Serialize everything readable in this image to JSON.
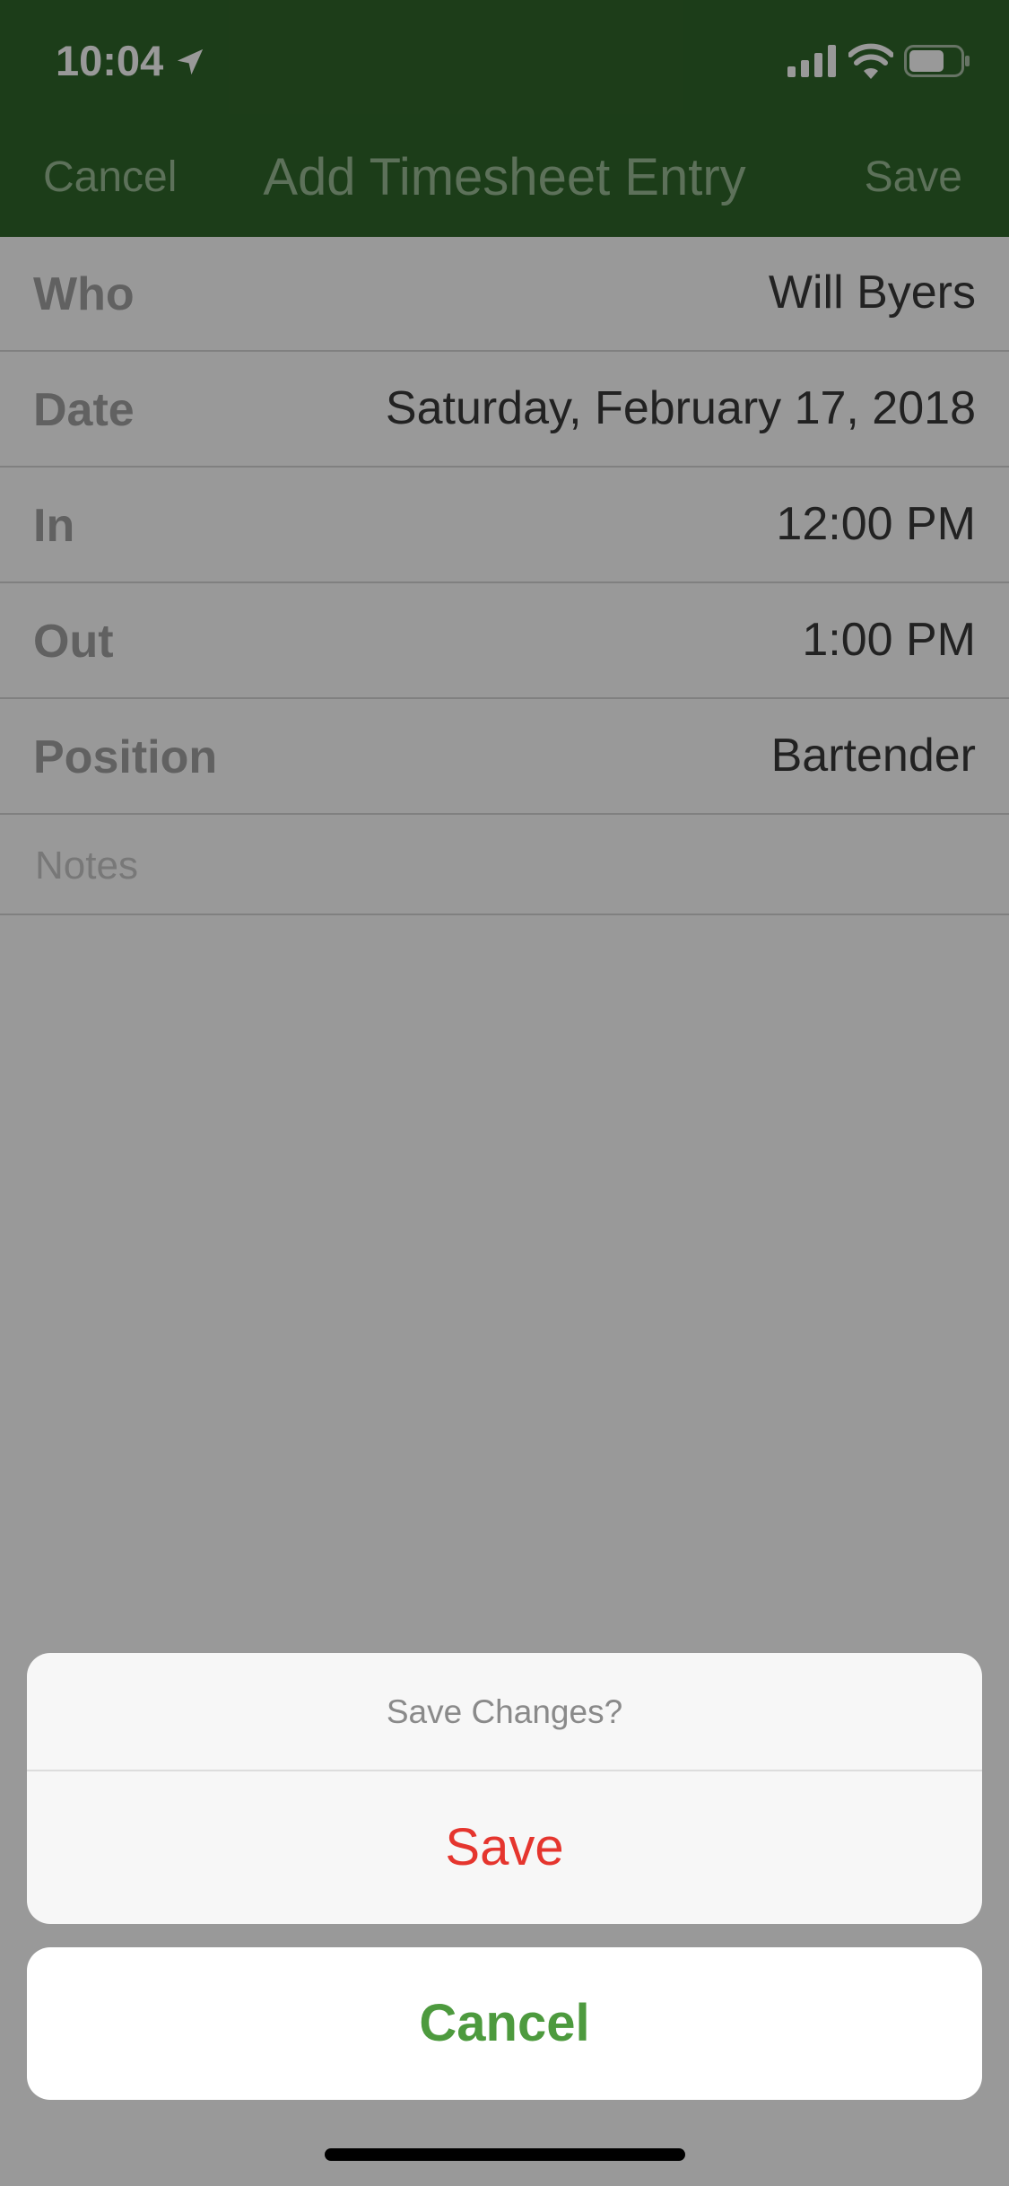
{
  "status_bar": {
    "time": "10:04",
    "icons": [
      "location-arrow-icon",
      "cellular-signal-icon",
      "wifi-icon",
      "battery-icon"
    ]
  },
  "nav": {
    "cancel_label": "Cancel",
    "title": "Add Timesheet Entry",
    "save_label": "Save"
  },
  "form": {
    "rows": [
      {
        "label": "Who",
        "value": "Will Byers"
      },
      {
        "label": "Date",
        "value": "Saturday, February 17, 2018"
      },
      {
        "label": "In",
        "value": "12:00 PM"
      },
      {
        "label": "Out",
        "value": "1:00 PM"
      },
      {
        "label": "Position",
        "value": "Bartender"
      }
    ],
    "notes_placeholder": "Notes"
  },
  "action_sheet": {
    "title": "Save Changes?",
    "save_label": "Save",
    "cancel_label": "Cancel"
  },
  "colors": {
    "header_green": "#30662a",
    "destructive_red": "#e5352e",
    "cancel_green": "#4d9a3e"
  }
}
